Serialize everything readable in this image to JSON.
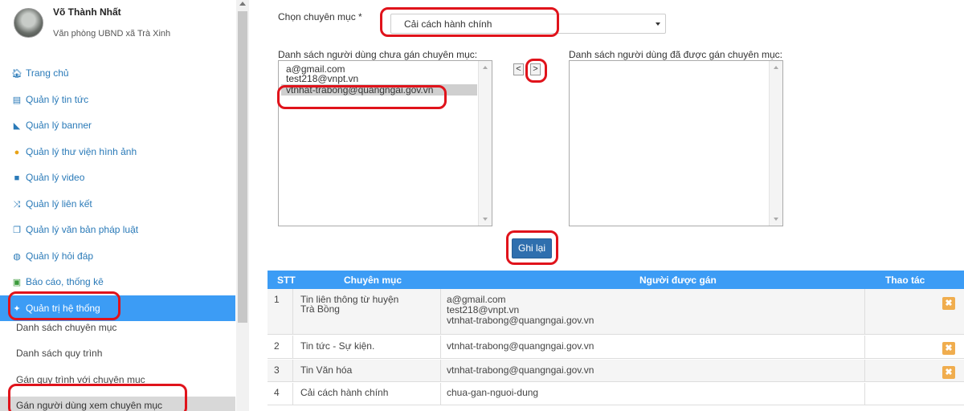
{
  "user": {
    "name": "Võ Thành Nhất",
    "org": "Văn phòng UBND xã Trà Xinh"
  },
  "menu": [
    {
      "label": "Trang chủ",
      "icon": "home-icon"
    },
    {
      "label": "Quản lý tin tức",
      "icon": "newspaper-icon"
    },
    {
      "label": "Quản lý banner",
      "icon": "area-chart-icon"
    },
    {
      "label": "Quản lý thư viện hình ảnh",
      "icon": "color-dot-icon"
    },
    {
      "label": "Quản lý video",
      "icon": "video-camera-icon"
    },
    {
      "label": "Quản lý liên kết",
      "icon": "shuffle-icon"
    },
    {
      "label": "Quản lý văn bản pháp luật",
      "icon": "documents-icon"
    },
    {
      "label": "Quản lý hỏi đáp",
      "icon": "chat-bubble-icon"
    },
    {
      "label": "Báo cáo, thống kê",
      "icon": "report-icon"
    },
    {
      "label": "Quản trị hệ thống",
      "icon": "wrench-icon"
    }
  ],
  "submenu": [
    "Danh sách chuyên mục",
    "Danh sách quy trình",
    "Gán quy trình với chuyên mục",
    "Gán người dùng xem chuyên mục"
  ],
  "form": {
    "category_label": "Chọn chuyên mục *",
    "category_value": "Cải cách hành chính",
    "unassigned_label": "Danh sách người dùng chưa gán chuyên mục:",
    "assigned_label": "Danh sách người dùng đã được gán chuyên mục:",
    "unassigned_users": [
      "a@gmail.com",
      "test218@vnpt.vn",
      "vtnhat-trabong@quangngai.gov.vn"
    ],
    "selected_user_index": 2,
    "assigned_users": [],
    "move_left": "<",
    "move_right": ">",
    "save_label": "Ghi lại"
  },
  "table": {
    "headers": [
      "STT",
      "Chuyên mục",
      "Người được gán",
      "Thao tác"
    ],
    "rows": [
      {
        "stt": "1",
        "category": "Tin liên thông từ huyện Trà Bồng",
        "users": [
          "a@gmail.com",
          "test218@vnpt.vn",
          "vtnhat-trabong@quangngai.gov.vn"
        ]
      },
      {
        "stt": "2",
        "category": "Tin tức - Sự kiện.",
        "users": [
          "vtnhat-trabong@quangngai.gov.vn"
        ]
      },
      {
        "stt": "3",
        "category": "Tin Văn hóa",
        "users": [
          "vtnhat-trabong@quangngai.gov.vn"
        ]
      },
      {
        "stt": "4",
        "category": "Cải cách hành chính",
        "users": [
          "chua-gan-nguoi-dung"
        ]
      }
    ],
    "delete_glyph": "✖"
  },
  "colors": {
    "accent": "#3c9cf5",
    "link": "#2a7ab8",
    "save_button": "#2f6fae",
    "delete_button": "#f0ad4e",
    "annotation": "#e0131b"
  }
}
